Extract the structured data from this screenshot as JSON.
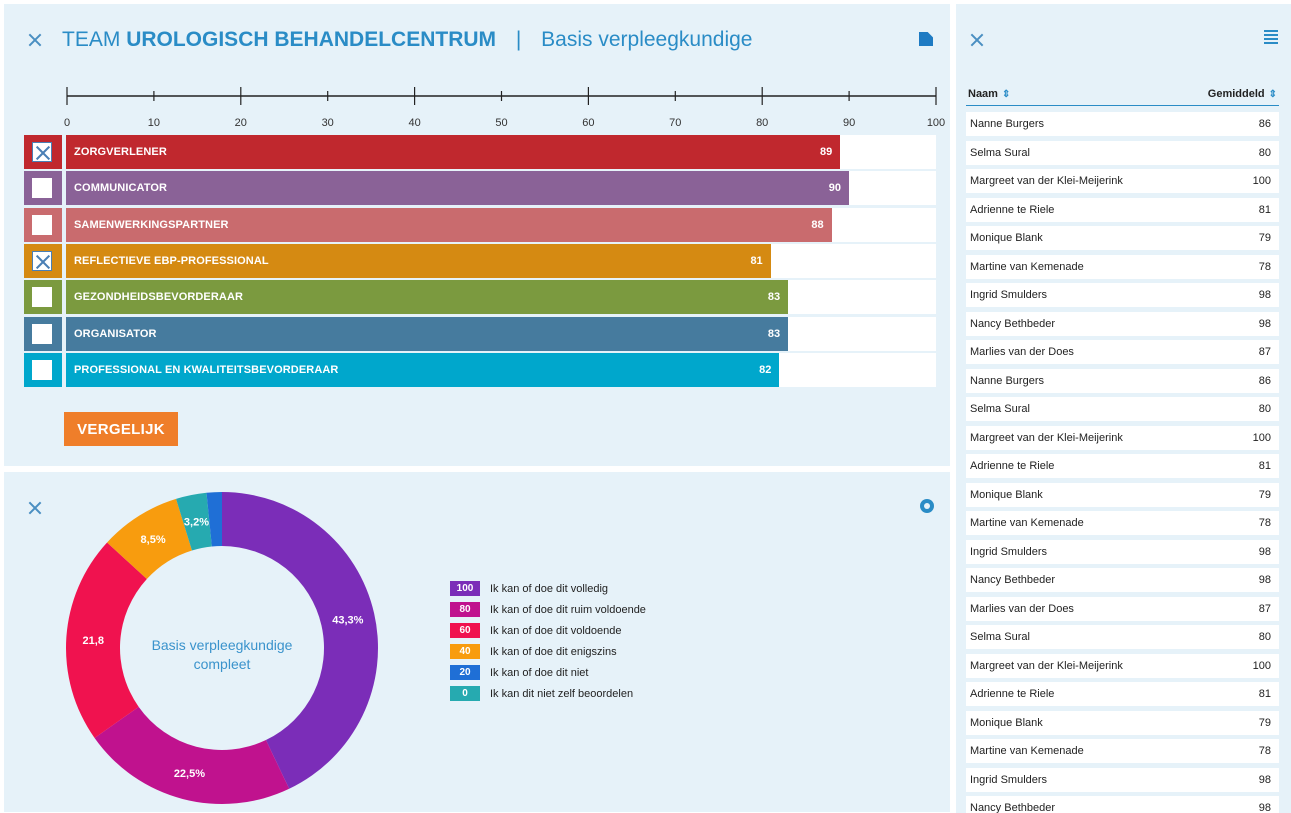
{
  "header": {
    "team_prefix": "TEAM",
    "team_name": "UROLOGISCH BEHANDELCENTRUM",
    "separator": "|",
    "subtitle": "Basis verpleegkundige"
  },
  "bar_chart": {
    "type": "bar",
    "ticks": [
      "0",
      "10",
      "20",
      "30",
      "40",
      "50",
      "60",
      "70",
      "80",
      "90",
      "100"
    ],
    "xlim": [
      0,
      100
    ],
    "rows": [
      {
        "label": "ZORGVERLENER",
        "value": 89,
        "value_text": "89",
        "color": "#c0282e",
        "checked": true
      },
      {
        "label": "COMMUNICATOR",
        "value": 90,
        "value_text": "90",
        "color": "#8a6297",
        "checked": false
      },
      {
        "label": "SAMENWERKINGSPARTNER",
        "value": 88,
        "value_text": "88",
        "color": "#c96b6e",
        "checked": false
      },
      {
        "label": "REFLECTIEVE EBP-PROFESSIONAL",
        "value": 81,
        "value_text": "81",
        "color": "#d58a12",
        "checked": true
      },
      {
        "label": "GEZONDHEIDSBEVORDERAAR",
        "value": 83,
        "value_text": "83",
        "color": "#7b9a3f",
        "checked": false
      },
      {
        "label": "ORGANISATOR",
        "value": 83,
        "value_text": "83",
        "color": "#467b9e",
        "checked": false
      },
      {
        "label": "PROFESSIONAL EN KWALITEITSBEVORDERAAR",
        "value": 82,
        "value_text": "82",
        "color": "#00a7cc",
        "checked": false
      }
    ]
  },
  "compare_button": "VERGELIJK",
  "chart_data": {
    "type": "pie",
    "center_label_line1": "Basis verpleegkundige",
    "center_label_line2": "compleet",
    "slices": [
      {
        "value": 43.3,
        "label": "43,3%",
        "color": "#7b2db8"
      },
      {
        "value": 22.5,
        "label": "22,5%",
        "color": "#c0128e"
      },
      {
        "value": 21.8,
        "label": "21,8",
        "color": "#f0124f"
      },
      {
        "value": 8.5,
        "label": "8,5%",
        "color": "#f89c0e"
      },
      {
        "value": 3.2,
        "label": "3,2%",
        "color": "#26aab0"
      },
      {
        "value": 1.6,
        "label": "",
        "color": "#1f6fd6"
      }
    ],
    "legend": [
      {
        "code": "100",
        "text": "Ik kan of doe dit volledig",
        "color": "#7b2db8"
      },
      {
        "code": "80",
        "text": "Ik kan of doe dit ruim voldoende",
        "color": "#c0128e"
      },
      {
        "code": "60",
        "text": "Ik kan of doe dit voldoende",
        "color": "#f0124f"
      },
      {
        "code": "40",
        "text": "Ik kan of doe dit enigszins",
        "color": "#f89c0e"
      },
      {
        "code": "20",
        "text": "Ik kan of doe dit niet",
        "color": "#1f6fd6"
      },
      {
        "code": "0",
        "text": "Ik kan dit niet zelf beoordelen",
        "color": "#26aab0"
      }
    ]
  },
  "table": {
    "col_name": "Naam",
    "col_avg": "Gemiddeld",
    "sort_icon": "⇕",
    "rows": [
      {
        "name": "Nanne Burgers",
        "value": "86"
      },
      {
        "name": "Selma Sural",
        "value": "80"
      },
      {
        "name": "Margreet van der Klei-Meijerink",
        "value": "100"
      },
      {
        "name": "Adrienne te Riele",
        "value": "81"
      },
      {
        "name": "Monique Blank",
        "value": "79"
      },
      {
        "name": "Martine van Kemenade",
        "value": "78"
      },
      {
        "name": "Ingrid Smulders",
        "value": "98"
      },
      {
        "name": "Nancy Bethbeder",
        "value": "98"
      },
      {
        "name": "Marlies van der Does",
        "value": "87"
      },
      {
        "name": "Nanne Burgers",
        "value": "86"
      },
      {
        "name": "Selma Sural",
        "value": "80"
      },
      {
        "name": "Margreet van der Klei-Meijerink",
        "value": "100"
      },
      {
        "name": "Adrienne te Riele",
        "value": "81"
      },
      {
        "name": "Monique Blank",
        "value": "79"
      },
      {
        "name": "Martine van Kemenade",
        "value": "78"
      },
      {
        "name": "Ingrid Smulders",
        "value": "98"
      },
      {
        "name": "Nancy Bethbeder",
        "value": "98"
      },
      {
        "name": "Marlies van der Does",
        "value": "87"
      },
      {
        "name": "Selma Sural",
        "value": "80"
      },
      {
        "name": "Margreet van der Klei-Meijerink",
        "value": "100"
      },
      {
        "name": "Adrienne te Riele",
        "value": "81"
      },
      {
        "name": "Monique Blank",
        "value": "79"
      },
      {
        "name": "Martine van Kemenade",
        "value": "78"
      },
      {
        "name": "Ingrid Smulders",
        "value": "98"
      },
      {
        "name": "Nancy Bethbeder",
        "value": "98"
      }
    ]
  },
  "icons": {
    "close": "close-icon",
    "export": "export-icon",
    "donut": "donut-chart-icon",
    "list": "list-view-icon"
  }
}
